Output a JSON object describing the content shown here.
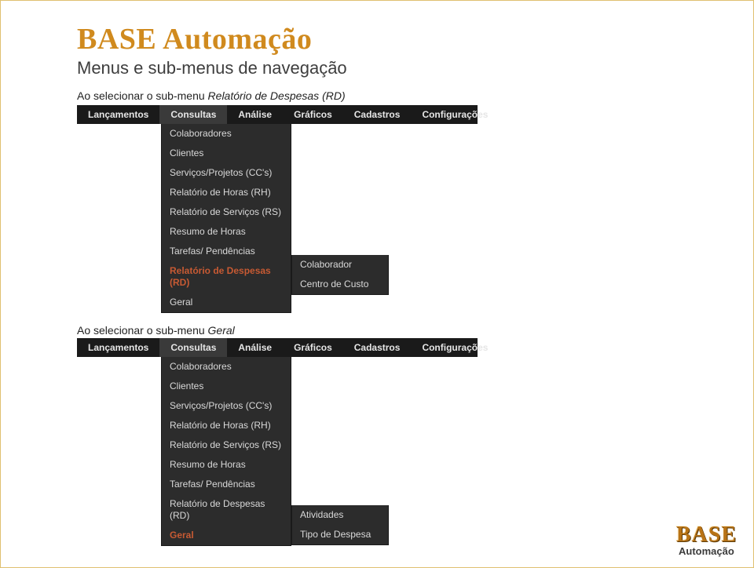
{
  "title": "BASE Automação",
  "subtitle": "Menus e sub-menus de navegação",
  "caption1_prefix": "Ao selecionar o sub-menu ",
  "caption1_italic": "Relatório de Despesas (RD)",
  "caption2_prefix": "Ao selecionar o sub-menu ",
  "caption2_italic": "Geral",
  "menubar": {
    "items": [
      "Lançamentos",
      "Consultas",
      "Análise",
      "Gráficos",
      "Cadastros",
      "Configurações"
    ]
  },
  "dropdown1": {
    "items": [
      {
        "label": "Colaboradores",
        "highlight": false
      },
      {
        "label": "Clientes",
        "highlight": false
      },
      {
        "label": "Serviços/Projetos (CC's)",
        "highlight": false
      },
      {
        "label": "Relatório de Horas (RH)",
        "highlight": false
      },
      {
        "label": "Relatório de Serviços (RS)",
        "highlight": false
      },
      {
        "label": "Resumo de Horas",
        "highlight": false
      },
      {
        "label": "Tarefas/ Pendências",
        "highlight": false
      },
      {
        "label": "Relatório de Despesas (RD)",
        "highlight": true
      },
      {
        "label": "Geral",
        "highlight": false
      }
    ]
  },
  "flyout1": {
    "items": [
      "Colaborador",
      "Centro de Custo"
    ]
  },
  "dropdown2": {
    "items": [
      {
        "label": "Colaboradores",
        "highlight": false
      },
      {
        "label": "Clientes",
        "highlight": false
      },
      {
        "label": "Serviços/Projetos (CC's)",
        "highlight": false
      },
      {
        "label": "Relatório de Horas (RH)",
        "highlight": false
      },
      {
        "label": "Relatório de Serviços (RS)",
        "highlight": false
      },
      {
        "label": "Resumo de Horas",
        "highlight": false
      },
      {
        "label": "Tarefas/ Pendências",
        "highlight": false
      },
      {
        "label": "Relatório de Despesas (RD)",
        "highlight": false
      },
      {
        "label": "Geral",
        "highlight": true
      }
    ]
  },
  "flyout2": {
    "items": [
      "Atividades",
      "Tipo de Despesa"
    ]
  },
  "logo": {
    "top": "BASE",
    "bottom": "Automação"
  }
}
